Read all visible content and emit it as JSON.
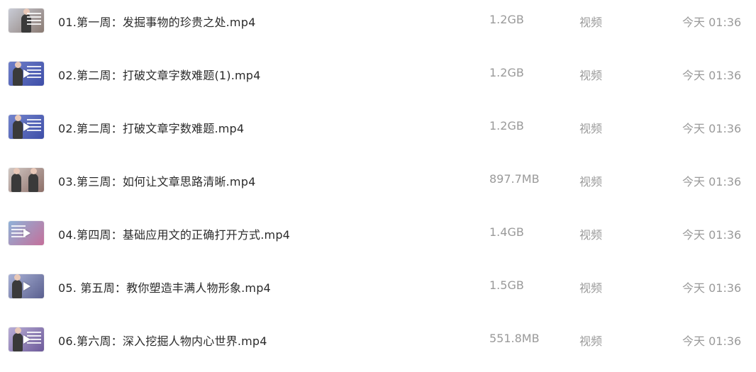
{
  "files": [
    {
      "name": "01.第一周：发掘事物的珍贵之处.mp4",
      "size": "1.2GB",
      "type": "视频",
      "modified": "今天 01:36",
      "thumbnail_icon": "video-thumbnail",
      "thumb_bg": "#c9ccd6",
      "thumb_accent": "#8a7a72",
      "has_play": false
    },
    {
      "name": "02.第二周：打破文章字数难题(1).mp4",
      "size": "1.2GB",
      "type": "视频",
      "modified": "今天 01:36",
      "thumbnail_icon": "video-thumbnail",
      "thumb_bg": "#6f7fc9",
      "thumb_accent": "#3e4ea8",
      "has_play": true
    },
    {
      "name": "02.第二周：打破文章字数难题.mp4",
      "size": "1.2GB",
      "type": "视频",
      "modified": "今天 01:36",
      "thumbnail_icon": "video-thumbnail",
      "thumb_bg": "#7384cc",
      "thumb_accent": "#3e4ea8",
      "has_play": true
    },
    {
      "name": "03.第三周：如何让文章思路清晰.mp4",
      "size": "897.7MB",
      "type": "视频",
      "modified": "今天 01:36",
      "thumbnail_icon": "video-thumbnail",
      "thumb_bg": "#d2c8c4",
      "thumb_accent": "#8d6f68",
      "has_play": false
    },
    {
      "name": "04.第四周：基础应用文的正确打开方式.mp4",
      "size": "1.4GB",
      "type": "视频",
      "modified": "今天 01:36",
      "thumbnail_icon": "video-thumbnail",
      "thumb_bg": "#8fb2d8",
      "thumb_accent": "#c46f9a",
      "has_play": true
    },
    {
      "name": "05. 第五周：教你塑造丰满人物形象.mp4",
      "size": "1.5GB",
      "type": "视频",
      "modified": "今天 01:36",
      "thumbnail_icon": "video-thumbnail",
      "thumb_bg": "#a9b2d6",
      "thumb_accent": "#5a5f8f",
      "has_play": true
    },
    {
      "name": "06.第六周：深入挖掘人物内心世界.mp4",
      "size": "551.8MB",
      "type": "视频",
      "modified": "今天 01:36",
      "thumbnail_icon": "video-thumbnail",
      "thumb_bg": "#b9aed6",
      "thumb_accent": "#6d5a9a",
      "has_play": true
    }
  ]
}
